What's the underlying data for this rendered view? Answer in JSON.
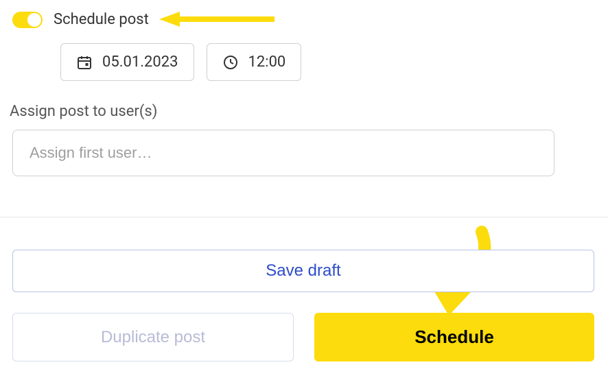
{
  "toggle": {
    "label": "Schedule post",
    "on": true
  },
  "datetime": {
    "date": "05.01.2023",
    "time": "12:00"
  },
  "assign": {
    "label": "Assign post to user(s)",
    "placeholder": "Assign first user…"
  },
  "buttons": {
    "save_draft": "Save draft",
    "duplicate": "Duplicate post",
    "schedule": "Schedule"
  },
  "colors": {
    "accent": "#fcdc0c",
    "link": "#2e4cc9"
  }
}
